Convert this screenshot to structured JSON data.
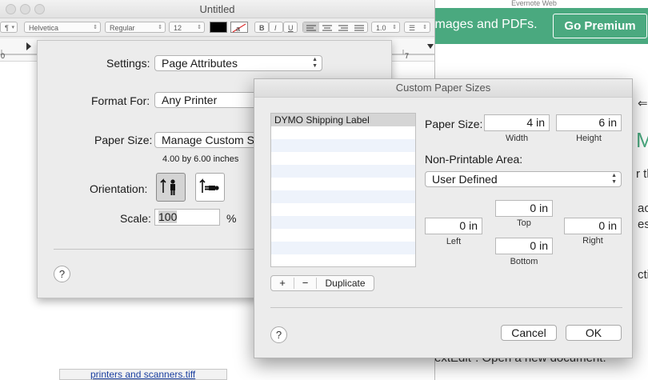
{
  "evernote": {
    "top_label": "Evernote Web",
    "banner_text": "images and PDFs.",
    "premium_button": "Go Premium",
    "big_letter": "M",
    "frag1": "r th",
    "frag2": "ack",
    "frag3": "esi",
    "frag4": "ctio",
    "tab_icon": "⇐",
    "bottom_text": "extEdit\". Open a new document.",
    "file_name": "printers and scanners.tiff"
  },
  "textedit": {
    "title": "Untitled",
    "toolbar": {
      "paragraph": "¶",
      "font_family": "Helvetica",
      "font_style": "Regular",
      "font_size": "12",
      "bold": "B",
      "italic": "I",
      "underline": "U",
      "line_spacing": "1.0",
      "list": "☰"
    },
    "ruler": {
      "mark_left": "0",
      "mark_right": "7"
    }
  },
  "page_setup": {
    "settings_label": "Settings:",
    "settings_value": "Page Attributes",
    "format_label": "Format For:",
    "format_value": "Any Printer",
    "paper_label": "Paper Size:",
    "paper_value": "Manage Custom Si",
    "paper_dims": "4.00 by 6.00 inches",
    "orientation_label": "Orientation:",
    "scale_label": "Scale:",
    "scale_value": "100",
    "scale_unit": "%",
    "help": "?"
  },
  "custom_paper": {
    "title": "Custom Paper Sizes",
    "list_items": [
      "DYMO Shipping Label"
    ],
    "add": "+",
    "remove": "−",
    "duplicate": "Duplicate",
    "paper_size_label": "Paper Size:",
    "width_value": "4 in",
    "height_value": "6 in",
    "width_label": "Width",
    "height_label": "Height",
    "nonprint_label": "Non-Printable Area:",
    "nonprint_value": "User Defined",
    "top_value": "0 in",
    "left_value": "0 in",
    "right_value": "0 in",
    "bottom_value": "0 in",
    "top_label": "Top",
    "left_label": "Left",
    "right_label": "Right",
    "bottom_label": "Bottom",
    "help": "?",
    "cancel": "Cancel",
    "ok": "OK"
  }
}
